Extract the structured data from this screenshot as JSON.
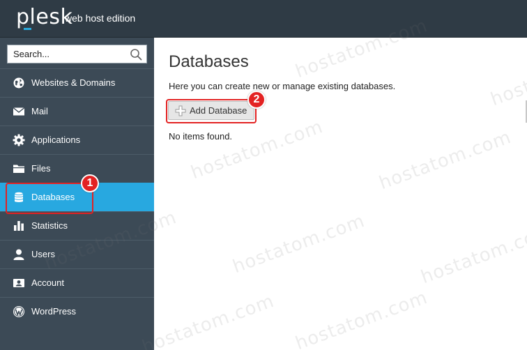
{
  "header": {
    "brand": "plesk",
    "edition": "web host edition"
  },
  "sidebar": {
    "search_placeholder": "Search...",
    "items": [
      {
        "label": "Websites & Domains",
        "icon": "globe-icon"
      },
      {
        "label": "Mail",
        "icon": "envelope-icon"
      },
      {
        "label": "Applications",
        "icon": "gear-icon"
      },
      {
        "label": "Files",
        "icon": "folder-icon"
      },
      {
        "label": "Databases",
        "icon": "database-icon",
        "active": true
      },
      {
        "label": "Statistics",
        "icon": "bar-chart-icon"
      },
      {
        "label": "Users",
        "icon": "user-icon"
      },
      {
        "label": "Account",
        "icon": "id-card-icon"
      },
      {
        "label": "WordPress",
        "icon": "wordpress-icon"
      }
    ]
  },
  "main": {
    "title": "Databases",
    "description": "Here you can create new or manage existing databases.",
    "add_button_label": "Add Database",
    "empty_message": "No items found."
  },
  "annotations": {
    "marker_1": "1",
    "marker_2": "2",
    "color": "#e32222"
  },
  "watermark": {
    "text": "hostatom.com"
  },
  "colors": {
    "topbar": "#2f3b45",
    "sidebar": "#3c4a56",
    "active": "#28a8e0"
  }
}
